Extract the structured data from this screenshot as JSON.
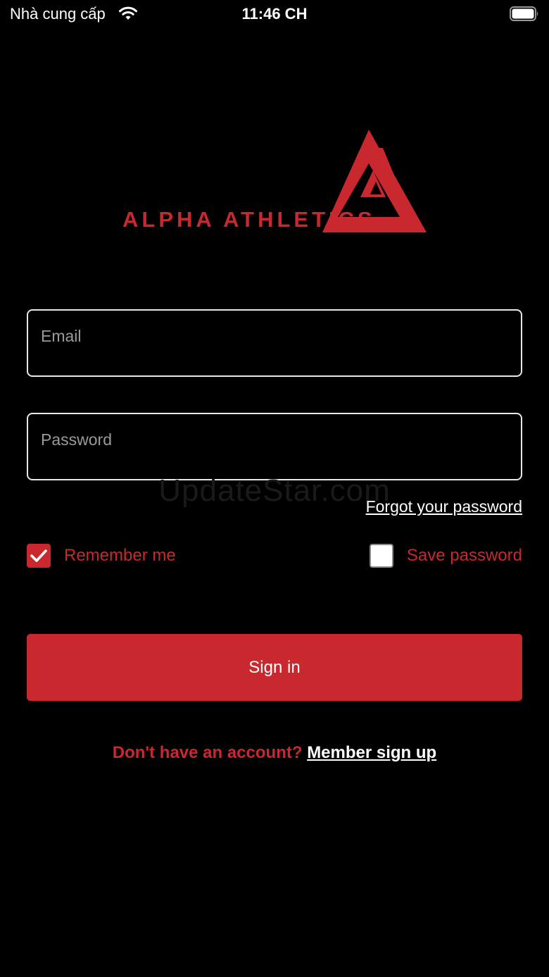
{
  "status_bar": {
    "carrier": "Nhà cung cấp",
    "time": "11:46 CH",
    "icons": [
      "wifi-icon",
      "battery-icon"
    ]
  },
  "logo": {
    "text": "ALPHA ATHLETICS",
    "brand_color": "#c8282e"
  },
  "form": {
    "email_placeholder": "Email",
    "email_value": "",
    "password_placeholder": "Password",
    "password_value": "",
    "forgot_password": "Forgot your password",
    "remember_me": {
      "label": "Remember me",
      "checked": true
    },
    "save_password": {
      "label": "Save password",
      "checked": false
    },
    "sign_in": "Sign in"
  },
  "signup": {
    "prompt": "Don't have an account?",
    "link": "Member sign up"
  },
  "watermark": "UpdateStar.com",
  "colors": {
    "background": "#000000",
    "accent": "#c8282e",
    "field_border": "#e8e8e8",
    "placeholder": "#9a9a9a"
  }
}
